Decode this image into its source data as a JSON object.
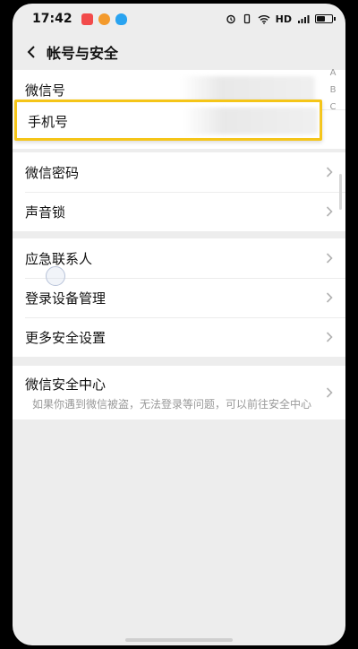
{
  "status": {
    "time": "17:42",
    "network": "HD",
    "battery_level": 0.6,
    "app_icons": [
      "video-app-icon",
      "weibo-icon",
      "qq-icon"
    ]
  },
  "header": {
    "back_icon": "chevron-left-icon",
    "title": "帐号与安全"
  },
  "index_letters": [
    "A",
    "B",
    "C"
  ],
  "group1": {
    "wechat_id_label": "微信号",
    "phone_label": "手机号"
  },
  "group2": {
    "items": [
      {
        "label": "微信密码"
      },
      {
        "label": "声音锁"
      }
    ]
  },
  "group3": {
    "items": [
      {
        "label": "应急联系人"
      },
      {
        "label": "登录设备管理"
      },
      {
        "label": "更多安全设置"
      }
    ]
  },
  "group4": {
    "title": "微信安全中心",
    "desc": "如果你遇到微信被盗，无法登录等问题，可以前往安全中心"
  },
  "colors": {
    "highlight": "#f5c518",
    "background": "#ededed"
  }
}
